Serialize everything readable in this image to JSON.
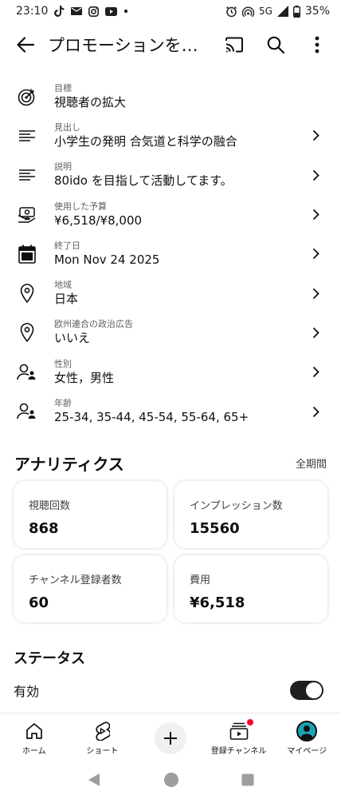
{
  "status_bar": {
    "time": "23:10",
    "network": "5G",
    "battery": "35%"
  },
  "app_bar": {
    "title": "プロモーションを…",
    "back_icon": "arrow-back-icon",
    "cast_icon": "cast-icon",
    "search_icon": "search-icon",
    "more_icon": "more-vert-icon"
  },
  "settings": [
    {
      "label": "目標",
      "value": "視聴者の拡大",
      "icon": "target-icon",
      "has_chevron": false
    },
    {
      "label": "見出し",
      "value": "小学生の発明 合気道と科学の融合",
      "icon": "text-lines-icon",
      "has_chevron": true
    },
    {
      "label": "説明",
      "value": "80ido を目指して活動してます。",
      "icon": "text-lines-icon",
      "has_chevron": true
    },
    {
      "label": "使用した予算",
      "value": "¥6,518/¥8,000",
      "icon": "budget-icon",
      "has_chevron": true
    },
    {
      "label": "終了日",
      "value": "Mon Nov 24 2025",
      "icon": "calendar-icon",
      "has_chevron": true
    },
    {
      "label": "地域",
      "value": "日本",
      "icon": "location-pin-icon",
      "has_chevron": true
    },
    {
      "label": "欧州連合の政治広告",
      "value": "いいえ",
      "icon": "location-pin-icon",
      "has_chevron": true
    },
    {
      "label": "性別",
      "value": "女性，男性",
      "icon": "audience-icon",
      "has_chevron": true
    },
    {
      "label": "年齢",
      "value": "25-34, 35-44, 45-54, 55-64, 65+",
      "icon": "audience-icon",
      "has_chevron": true
    }
  ],
  "analytics": {
    "title": "アナリティクス",
    "period": "全期間",
    "cards": [
      {
        "label": "視聴回数",
        "value": "868"
      },
      {
        "label": "インプレッション数",
        "value": "15560"
      },
      {
        "label": "チャンネル登録者数",
        "value": "60"
      },
      {
        "label": "費用",
        "value": "¥6,518"
      }
    ]
  },
  "status": {
    "title": "ステータス",
    "label": "有効",
    "enabled": true
  },
  "bottom_nav": [
    {
      "label": "ホーム",
      "icon": "home-icon"
    },
    {
      "label": "ショート",
      "icon": "shorts-icon"
    },
    {
      "label": "",
      "icon": "create-icon"
    },
    {
      "label": "登録チャンネル",
      "icon": "subscriptions-icon"
    },
    {
      "label": "マイページ",
      "icon": "avatar-icon"
    }
  ],
  "colors": {
    "notification_dot": "#ff0033",
    "toggle_on": "#1f1f1f",
    "avatar": "#1ba3b5"
  }
}
